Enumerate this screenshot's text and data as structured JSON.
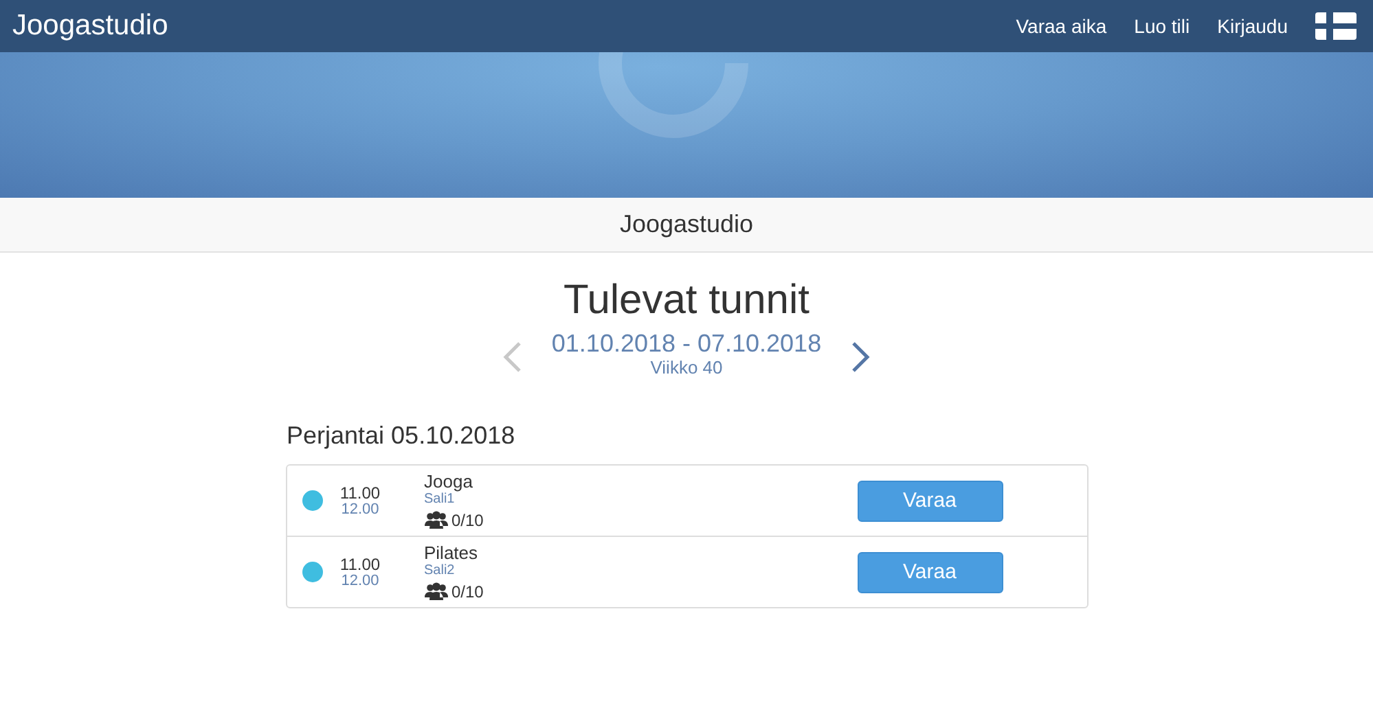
{
  "navbar": {
    "brand": "Joogastudio",
    "links": [
      "Varaa aika",
      "Luo tili",
      "Kirjaudu"
    ]
  },
  "subheader": {
    "title": "Joogastudio"
  },
  "schedule": {
    "title": "Tulevat tunnit",
    "range": "01.10.2018 - 07.10.2018",
    "week": "Viikko 40",
    "prev_disabled": true,
    "next_disabled": false
  },
  "days": [
    {
      "heading": "Perjantai 05.10.2018",
      "classes": [
        {
          "color": "#3fbde0",
          "start": "11.00",
          "end": "12.00",
          "name": "Jooga",
          "room": "Sali1",
          "capacity": "0/10",
          "button": "Varaa"
        },
        {
          "color": "#3fbde0",
          "start": "11.00",
          "end": "12.00",
          "name": "Pilates",
          "room": "Sali2",
          "capacity": "0/10",
          "button": "Varaa"
        }
      ]
    }
  ]
}
